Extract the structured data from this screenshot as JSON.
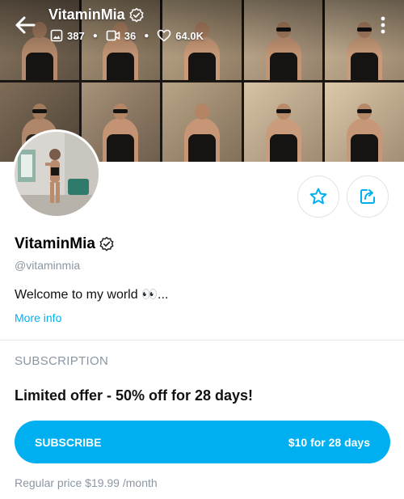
{
  "cover": {
    "name": "VitaminMia",
    "stats": {
      "photos": "387",
      "videos": "36",
      "likes": "64.0K"
    },
    "icons": [
      "back-arrow-icon",
      "photo-icon",
      "video-icon",
      "heart-icon",
      "more-vertical-icon",
      "verified-icon"
    ]
  },
  "profile": {
    "display_name": "VitaminMia",
    "handle": "@vitaminmia",
    "bio": "Welcome to my world 👀...",
    "more_info": "More info"
  },
  "actions": {
    "favorite_icon": "star-icon",
    "share_icon": "share-icon"
  },
  "subscription": {
    "heading": "SUBSCRIPTION",
    "offer": "Limited offer - 50% off for 28 days!",
    "button_label": "SUBSCRIBE",
    "button_price": "$10 for 28 days",
    "regular_price": "Regular price $19.99 /month"
  },
  "colors": {
    "accent": "#00aff0",
    "muted": "#8a96a3",
    "divider": "#e6e9ec"
  }
}
